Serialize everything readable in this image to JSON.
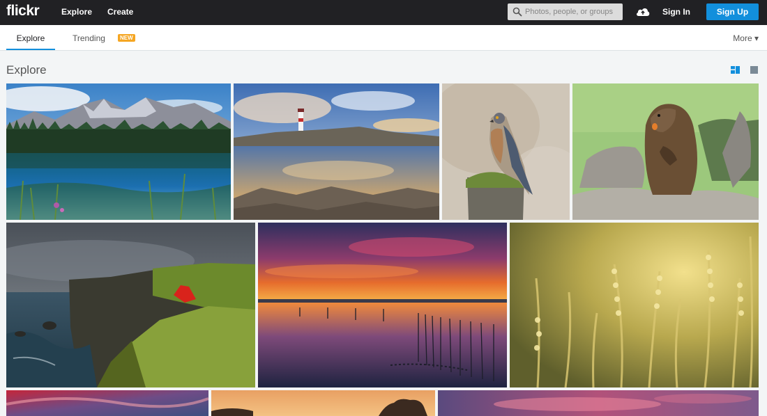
{
  "header": {
    "logo": "flickr",
    "nav": {
      "explore": "Explore",
      "create": "Create"
    },
    "search": {
      "placeholder": "Photos, people, or groups",
      "value": ""
    },
    "sign_in": "Sign In",
    "sign_up": "Sign Up"
  },
  "subnav": {
    "tabs": [
      {
        "label": "Explore",
        "active": true
      },
      {
        "label": "Trending",
        "badge": "NEW"
      }
    ],
    "more": "More ▾"
  },
  "page": {
    "title": "Explore"
  },
  "colors": {
    "topbar": "#212124",
    "accent": "#128fdc",
    "badge": "#f5a623",
    "page_bg": "#f3f5f6"
  },
  "icons": [
    "search-icon",
    "upload-cloud-icon",
    "justified-view-icon",
    "single-view-icon",
    "caret-down-icon"
  ],
  "photos": [
    "alpine-lake-photo",
    "lighthouse-coast-photo",
    "hawk-on-post-photo",
    "nutria-on-rocks-photo",
    "cliff-red-dress-photo",
    "sunset-lagoon-photo",
    "golden-grass-photo",
    "red-sky-photo",
    "tree-sunset-photo",
    "purple-clouds-photo"
  ]
}
